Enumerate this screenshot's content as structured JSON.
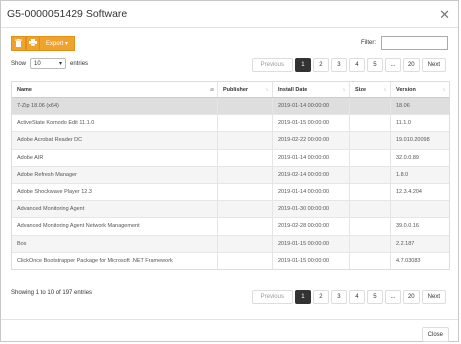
{
  "dialog": {
    "title": "G5-0000051429 Software",
    "close_label": "Close"
  },
  "toolbar": {
    "export_label": "Export ▾",
    "filter_label": "Filter:",
    "filter_value": ""
  },
  "length": {
    "show_label": "Show",
    "selected": "10",
    "entries_label": "entries"
  },
  "pagination": {
    "previous": "Previous",
    "next": "Next",
    "pages": [
      "1",
      "2",
      "3",
      "4",
      "5",
      "...",
      "20"
    ],
    "active": "1"
  },
  "table": {
    "columns": [
      "Name",
      "Publisher",
      "Install Date",
      "Size",
      "Version"
    ],
    "rows": [
      [
        "7-Zip 18.06 (x64)",
        "",
        "2019-01-14 00:00:00",
        "",
        "18.06"
      ],
      [
        "ActiveState Komodo Edit 11.1.0",
        "",
        "2019-01-15 00:00:00",
        "",
        "11.1.0"
      ],
      [
        "Adobe Acrobat Reader DC",
        "",
        "2019-02-22 00:00:00",
        "",
        "19.010.20098"
      ],
      [
        "Adobe AIR",
        "",
        "2019-01-14 00:00:00",
        "",
        "32.0.0.89"
      ],
      [
        "Adobe Refresh Manager",
        "",
        "2019-02-14 00:00:00",
        "",
        "1.8.0"
      ],
      [
        "Adobe Shockwave Player 12.3",
        "",
        "2019-01-14 00:00:00",
        "",
        "12.3.4.204"
      ],
      [
        "Advanced Monitoring Agent",
        "",
        "2019-01-30 00:00:00",
        "",
        ""
      ],
      [
        "Advanced Monitoring Agent Network Management",
        "",
        "2019-02-28 00:00:00",
        "",
        "39.0.0.16"
      ],
      [
        "Box",
        "",
        "2019-01-15 00:00:00",
        "",
        "2.2.187"
      ],
      [
        "ClickOnce Bootstrapper Package for Microsoft .NET Framework",
        "",
        "2019-01-15 00:00:00",
        "",
        "4.7.03083"
      ]
    ]
  },
  "info": "Showing 1 to 10 of 197 entries"
}
